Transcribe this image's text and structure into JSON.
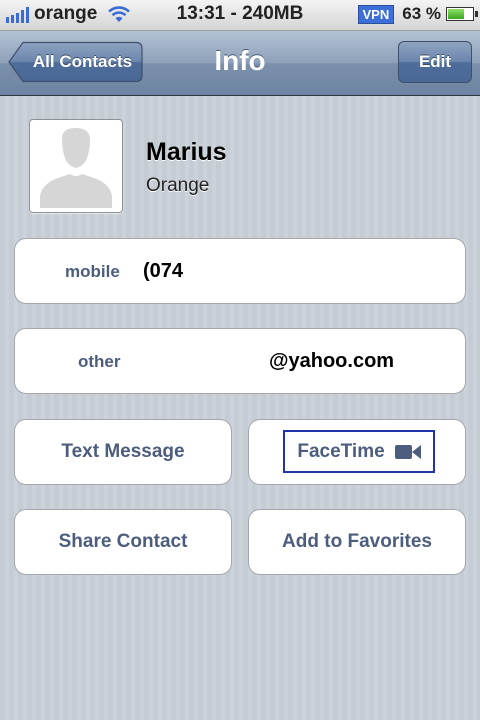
{
  "status_bar": {
    "carrier": "orange",
    "time_info": "13:31 - 240MB",
    "vpn_label": "VPN",
    "battery_pct": "63 %",
    "battery_level": 0.63,
    "icons": [
      "signal-icon",
      "wifi-icon",
      "battery-icon"
    ]
  },
  "nav": {
    "back_label": "All Contacts",
    "title": "Info",
    "edit_label": "Edit"
  },
  "contact": {
    "name": "Marius",
    "company": "Orange"
  },
  "fields": [
    {
      "label": "mobile",
      "value": "(074"
    },
    {
      "label": "other",
      "value": "@yahoo.com"
    }
  ],
  "actions": {
    "text_message": "Text Message",
    "facetime": "FaceTime",
    "share_contact": "Share Contact",
    "add_favorites": "Add to Favorites"
  },
  "colors": {
    "label_blue": "#4c5d7e",
    "nav_blue": "#6d84a2",
    "background": "#c5ccd4"
  }
}
